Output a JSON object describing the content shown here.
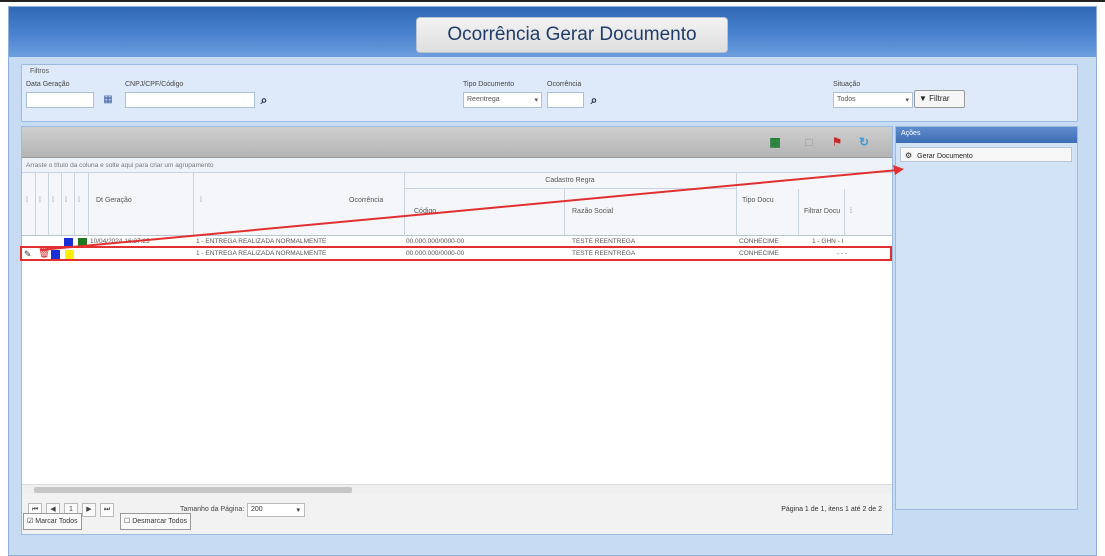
{
  "header": {
    "title": "Ocorrência Gerar Documento"
  },
  "filters": {
    "legend": "Filtros",
    "data_geracao_label": "Data Geração",
    "cnpj_label": "CNPJ/CPF/Código",
    "tipo_documento_label": "Tipo Documento",
    "tipo_documento_value": "Reentrega",
    "ocorrencia_label": "Ocorrência",
    "situacao_label": "Situação",
    "situacao_value": "Todos",
    "filter_button": "Filtrar"
  },
  "grid": {
    "group_hint": "Arraste o título da coluna e solte aqui para criar um agrupamento",
    "group_header": "Cadastro Regra",
    "columns": {
      "dt_geracao": "Dt Geração",
      "ocorrencia": "Ocorrência",
      "codigo": "Código",
      "razao_social": "Razão Social",
      "tipo_doc": "Tipo Docu",
      "filtrar_doc": "Filtrar Docu"
    },
    "rows": [
      {
        "dt_geracao": "10/04/2024 16:27:25",
        "ocorrencia": "1 - ENTREGA REALIZADA NORMALMENTE",
        "codigo": "00.000.000/0000-00",
        "razao_social": "TESTE REENTREGA",
        "tipo_doc": "CONHECIME",
        "filtrar_doc": "1 - GHN - I"
      },
      {
        "dt_geracao": "",
        "ocorrencia": "1 - ENTREGA REALIZADA NORMALMENTE",
        "codigo": "00.000.000/0000-00",
        "razao_social": "TESTE REENTREGA",
        "tipo_doc": "CONHECIME",
        "filtrar_doc": "- - -"
      }
    ],
    "status_colors": {
      "blue": "#1a2fd6",
      "green": "#1f7a1f",
      "yellow": "#ffee00",
      "delete": "#d62020"
    }
  },
  "pager": {
    "page": "1",
    "page_size_label": "Tamanho da Página:",
    "page_size": "200",
    "info": "Página 1 de 1, itens 1 até 2 de 2"
  },
  "bottom": {
    "mark_all": "Marcar Todos",
    "unmark_all": "Desmarcar Todos"
  },
  "actions": {
    "title": "Ações",
    "generate_document": "Gerar Documento"
  },
  "colors": {
    "annotation_arrow": "#e23030",
    "header_blue": "#3d74c4"
  }
}
